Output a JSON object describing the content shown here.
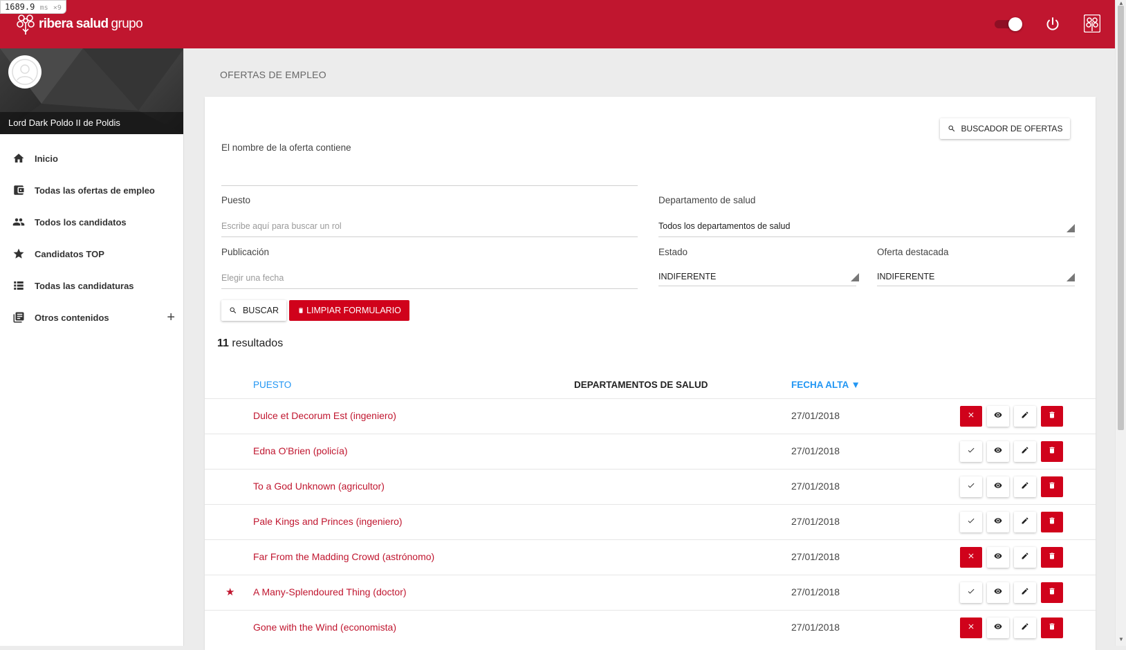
{
  "perf": {
    "value": "1689.9",
    "unit": "ms",
    "mult": "×9"
  },
  "header": {
    "brand": "ribera salud",
    "brand_suffix": "grupo",
    "toggle_on": true
  },
  "user": {
    "name": "Lord Dark Poldo II de Poldis"
  },
  "nav": [
    {
      "label": "Inicio",
      "icon": "home-icon"
    },
    {
      "label": "Todas las ofertas de empleo",
      "icon": "wallet-icon"
    },
    {
      "label": "Todos los candidatos",
      "icon": "people-icon"
    },
    {
      "label": "Candidatos TOP",
      "icon": "star-icon"
    },
    {
      "label": "Todas las candidaturas",
      "icon": "list-icon"
    },
    {
      "label": "Otros contenidos",
      "icon": "library-icon",
      "expand": "+"
    }
  ],
  "page": {
    "title": "OFERTAS DE EMPLEO"
  },
  "filters": {
    "search_offers_button": "BUSCADOR DE OFERTAS",
    "name_label": "El nombre de la oferta contiene",
    "name_value": "",
    "puesto_label": "Puesto",
    "puesto_placeholder": "Escribe aquí para buscar un rol",
    "dept_label": "Departamento de salud",
    "dept_value": "Todos los departamentos de salud",
    "publicacion_label": "Publicación",
    "publicacion_placeholder": "Elegir una fecha",
    "estado_label": "Estado",
    "estado_value": "INDIFERENTE",
    "destacada_label": "Oferta destacada",
    "destacada_value": "INDIFERENTE",
    "buscar_button": "BUSCAR",
    "limpiar_button": "LIMPIAR FORMULARIO"
  },
  "results": {
    "count": "11",
    "label": "resultados"
  },
  "table": {
    "col_puesto": "PUESTO",
    "col_departamentos": "DEPARTAMENTOS DE SALUD",
    "col_fecha": "FECHA ALTA ▼",
    "rows": [
      {
        "title": "Dulce et Decorum Est (ingeniero)",
        "date": "27/01/2018",
        "starred": false,
        "published": true
      },
      {
        "title": "Edna O'Brien (policía)",
        "date": "27/01/2018",
        "starred": false,
        "published": false
      },
      {
        "title": "To a God Unknown (agricultor)",
        "date": "27/01/2018",
        "starred": false,
        "published": false
      },
      {
        "title": "Pale Kings and Princes (ingeniero)",
        "date": "27/01/2018",
        "starred": false,
        "published": false
      },
      {
        "title": "Far From the Madding Crowd (astrónomo)",
        "date": "27/01/2018",
        "starred": false,
        "published": true
      },
      {
        "title": "A Many-Splendoured Thing (doctor)",
        "date": "27/01/2018",
        "starred": true,
        "published": false
      },
      {
        "title": "Gone with the Wind (economista)",
        "date": "27/01/2018",
        "starred": false,
        "published": true
      }
    ]
  },
  "colors": {
    "brand": "#c0162f",
    "action_red": "#d0021b",
    "link_blue": "#2196f3"
  }
}
